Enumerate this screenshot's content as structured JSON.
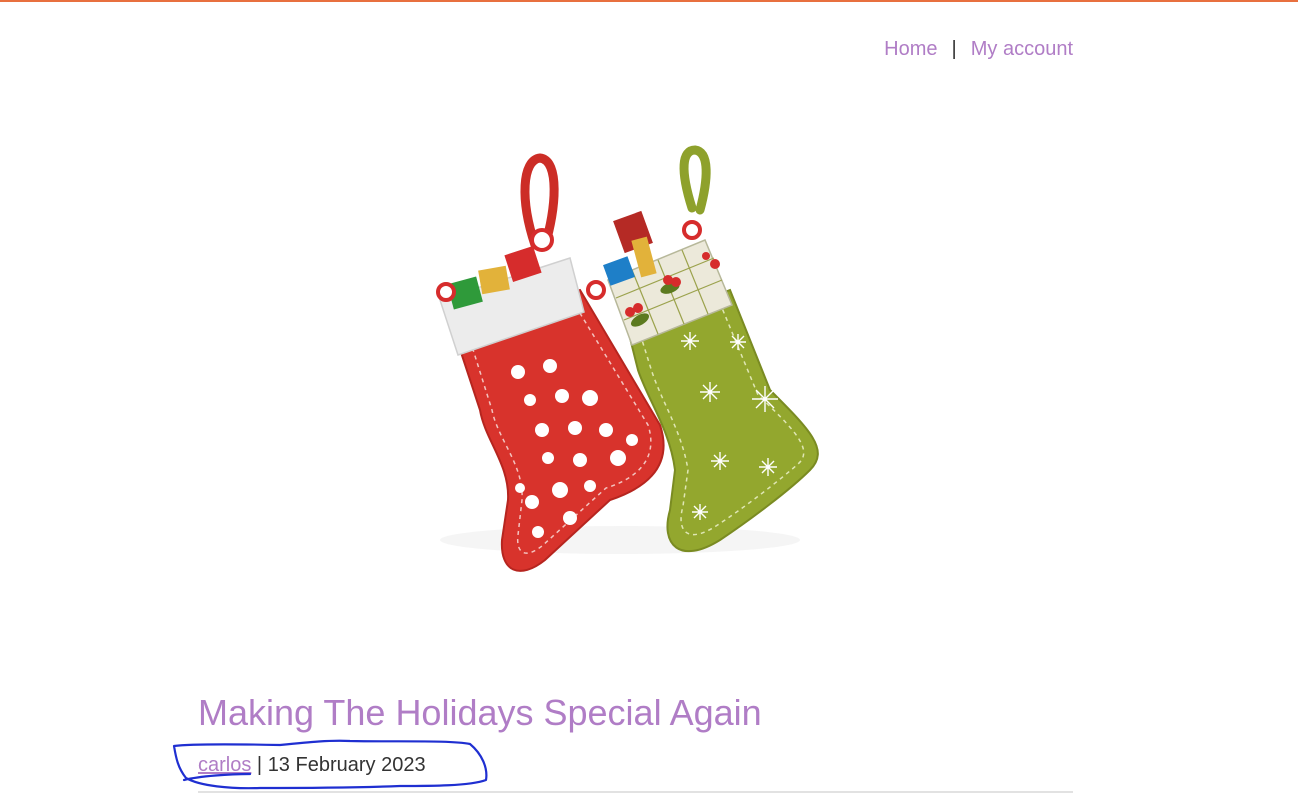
{
  "nav": {
    "home_label": "Home",
    "separator": "|",
    "account_label": "My account"
  },
  "hero": {
    "icon": "christmas-stockings-image",
    "colors": {
      "red_stocking": "#d8332c",
      "green_stocking": "#93a72e",
      "cuff": "#ececec"
    }
  },
  "post": {
    "title": "Making The Holidays Special Again",
    "author": "carlos",
    "separator": "|",
    "date": "13 February 2023"
  },
  "colors": {
    "accent": "#b07dc6",
    "top_border": "#e8703f",
    "annotation": "#1f2fd1"
  }
}
